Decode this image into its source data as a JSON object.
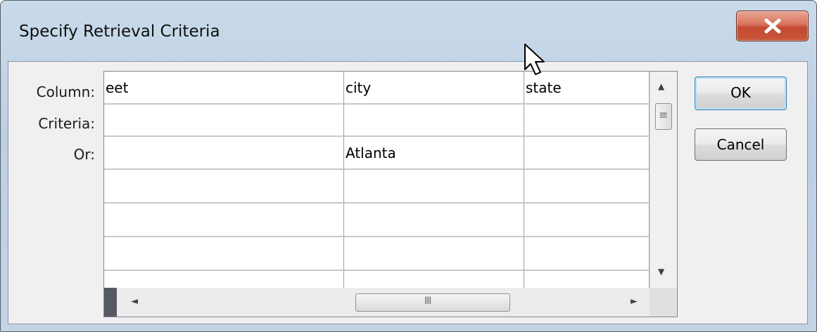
{
  "window": {
    "title": "Specify Retrieval Criteria",
    "close_glyph": "X"
  },
  "row_labels": [
    "Column:",
    "Criteria:",
    "Or:"
  ],
  "grid": {
    "columns": [
      "eet",
      "city",
      "state"
    ],
    "rows": [
      [
        "",
        "",
        ""
      ],
      [
        "",
        "Atlanta",
        ""
      ],
      [
        "",
        "",
        ""
      ],
      [
        "",
        "",
        ""
      ],
      [
        "",
        "",
        ""
      ]
    ]
  },
  "scrollbars": {
    "horizontal_grip": "III",
    "vertical_grip": "≡",
    "up_arrow": "▲",
    "down_arrow": "▼",
    "left_arrow": "◄",
    "right_arrow": "►"
  },
  "buttons": {
    "ok": "OK",
    "cancel": "Cancel"
  }
}
